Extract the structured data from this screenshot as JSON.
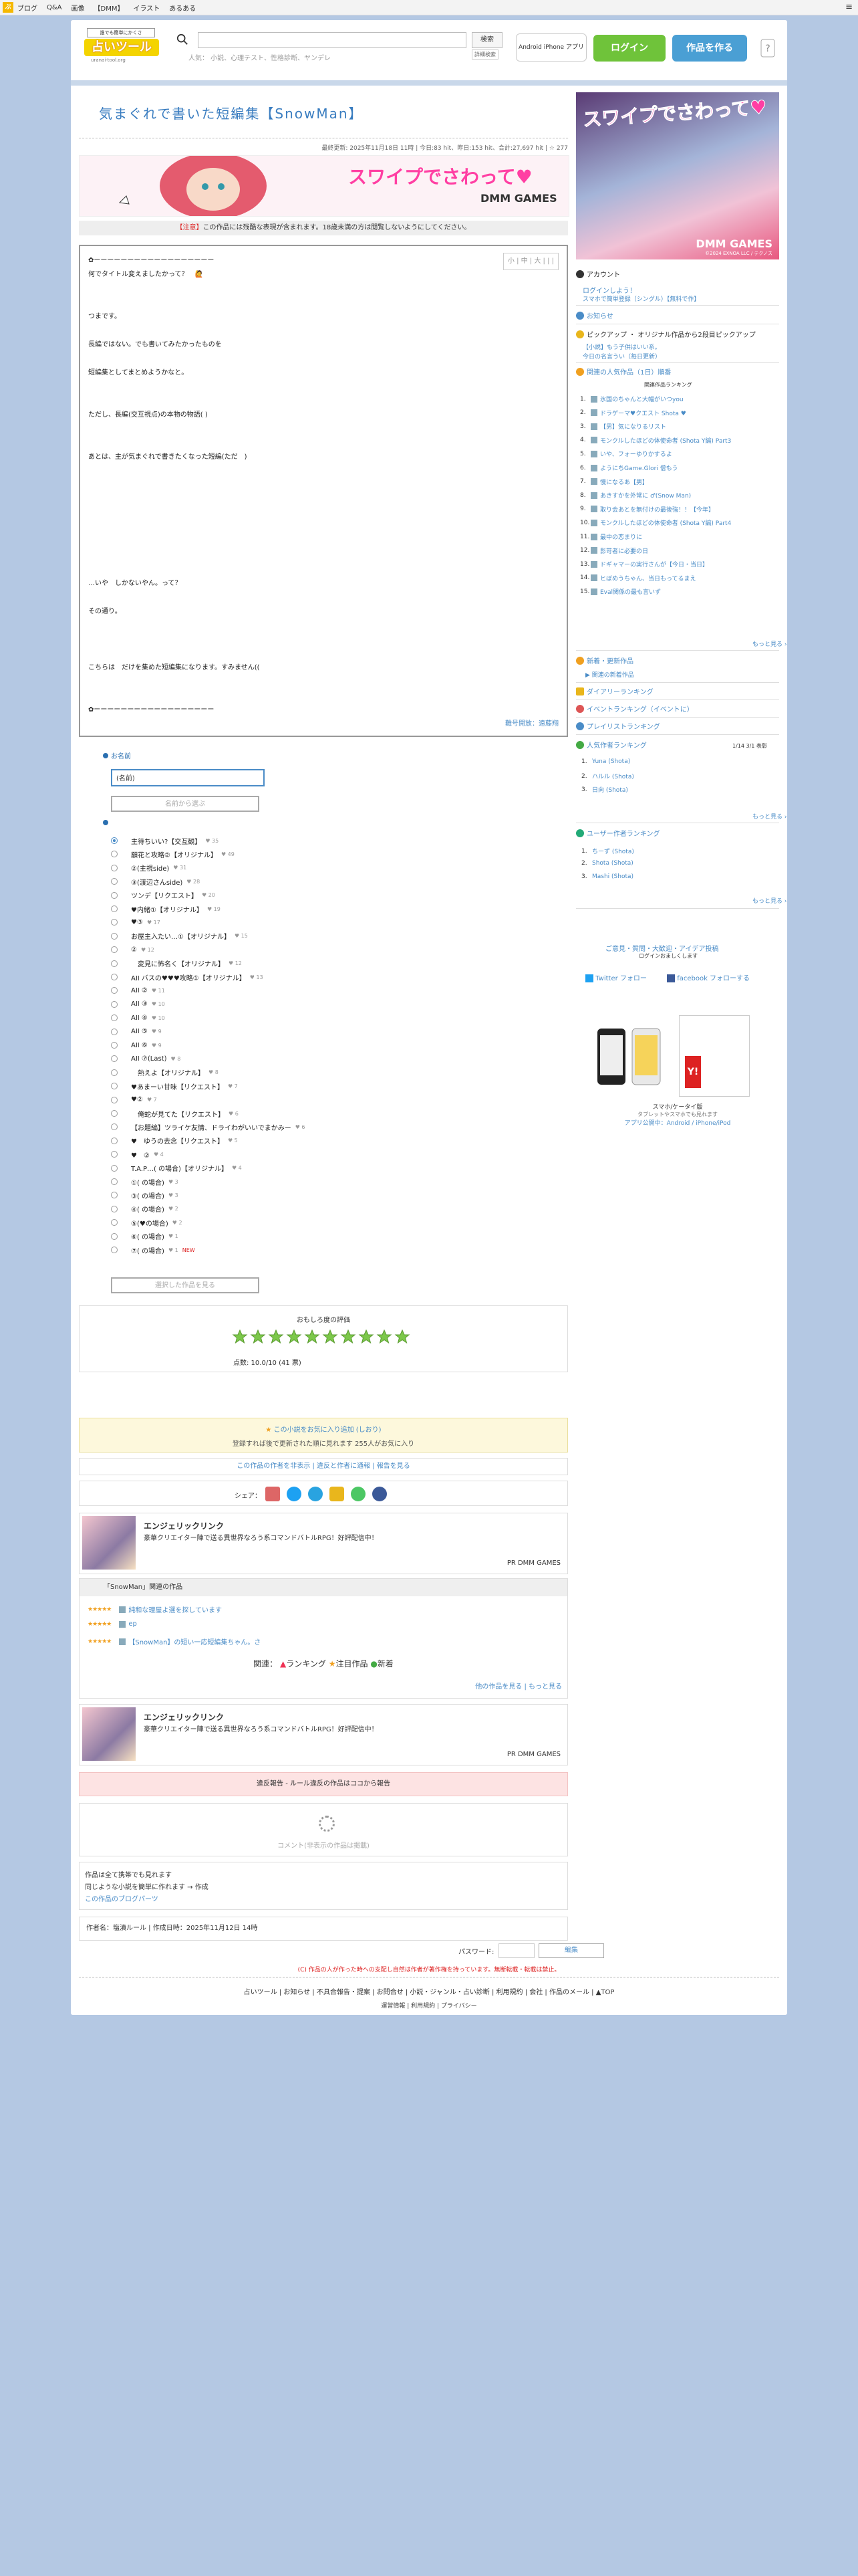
{
  "topbar": {
    "logo": "ぷ",
    "items": [
      "ブログ",
      "Q&A",
      "画像",
      "【DMM】",
      "イラスト",
      "あるある"
    ],
    "menu": "≡"
  },
  "header": {
    "logo_tag": "誰でも簡単にかくさ",
    "logo_name": "占いツール",
    "logo_sub": "uranai-tool.org",
    "search_button": "検索",
    "search_detail": "詳細検索",
    "search_hint": "人気： 小説、心理テスト、性格診断、ヤンデレ",
    "app_badge": "Android iPhone アプリ",
    "login": "ログイン",
    "make": "作品を作る"
  },
  "story": {
    "title": "気まぐれで書いた短編集【SnowMan】",
    "meta": "最終更新: 2025年11月18日 11時 | 今日:83 hit、昨日:153 hit、合計:27,697 hit | ☆ 277",
    "notice_tag": "【注意】",
    "notice": "この作品には残酷な表現が含まれます。18歳未満の方は閲覧しないようにしてください。",
    "tools": "小 | 中 | 大 |    |    |",
    "lines": [
      "✿ーーーーーーーーーーーーーーーーーー",
      "何でタイトル変えましたかって？　🙋",
      "",
      "",
      "つまです。",
      "",
      "長編ではない。でも書いてみたかったものを",
      "",
      "短編集としてまとめようかなと。",
      "",
      "",
      "ただし、長編(交互視点)の本物の物語( )",
      "",
      "",
      "あとは、主が気まぐれで書きたくなった短編(ただ　)",
      "",
      "",
      "",
      "",
      "",
      "",
      "",
      "",
      "…いや　しかないやん。って？",
      "",
      "その通り。",
      "",
      "",
      "",
      "こちらは　だけを集めた短編集になります。すみません((",
      "",
      "",
      "✿ーーーーーーーーーーーーーーーーーー"
    ],
    "foot": "難号開放：遠藤翔"
  },
  "poll": {
    "label_name": "お名前",
    "name_value": "(名前)",
    "name_btn": "名前から選ぶ",
    "options": [
      {
        "label": "主待ちいい?【交互観】",
        "cnt": "♥ 35"
      },
      {
        "label": "願花と攻略②【オリジナル】",
        "cnt": "♥ 49"
      },
      {
        "label": "②(主視side)",
        "cnt": "♥ 31"
      },
      {
        "label": "③(渡辺さんside)",
        "cnt": "♥ 28"
      },
      {
        "label": "ツンデ【リクエスト】",
        "cnt": "♥ 20"
      },
      {
        "label": "♥内緒①【オリジナル】",
        "cnt": "♥ 19"
      },
      {
        "label": "♥③",
        "cnt": "♥ 17"
      },
      {
        "label": "お屋主入たい…①【オリジナル】",
        "cnt": "♥ 15"
      },
      {
        "label": "②",
        "cnt": "♥ 12"
      },
      {
        "label": "　変見に怖名く【オリジナル】",
        "cnt": "♥ 12"
      },
      {
        "label": "AII バスの♥♥♥攻略①【オリジナル】",
        "cnt": "♥ 13"
      },
      {
        "label": "AII ②",
        "cnt": "♥ 11"
      },
      {
        "label": "AII ③",
        "cnt": "♥ 10"
      },
      {
        "label": "AII ④",
        "cnt": "♥ 10"
      },
      {
        "label": "AII ⑤",
        "cnt": "♥ 9"
      },
      {
        "label": "AII ⑥",
        "cnt": "♥ 9"
      },
      {
        "label": "AII ⑦(Last)",
        "cnt": "♥ 8"
      },
      {
        "label": "　熱えよ【オリジナル】",
        "cnt": "♥ 8"
      },
      {
        "label": "♥あまーい甘味【リクエスト】",
        "cnt": "♥ 7"
      },
      {
        "label": "♥②",
        "cnt": "♥ 7"
      },
      {
        "label": "　俺蛇が見てた【リクエスト】",
        "cnt": "♥ 6"
      },
      {
        "label": "【お題編】ツライケ友情、ドライわがいいでまかみー",
        "cnt": "♥ 6"
      },
      {
        "label": "♥　ゆうの去念【リクエスト】",
        "cnt": "♥ 5"
      },
      {
        "label": "♥　②",
        "cnt": "♥ 4"
      },
      {
        "label": "T.A.P…( の場合)【オリジナル】",
        "cnt": "♥ 4"
      },
      {
        "label": "①( の場合)",
        "cnt": "♥ 3"
      },
      {
        "label": "③( の場合)",
        "cnt": "♥ 3"
      },
      {
        "label": "④( の場合)",
        "cnt": "♥ 2"
      },
      {
        "label": "⑤(♥の場合)",
        "cnt": "♥ 2"
      },
      {
        "label": "⑥( の場合)",
        "cnt": "♥ 1"
      },
      {
        "label": "⑦( の場合)",
        "cnt": "♥ 1",
        "new": "NEW"
      }
    ],
    "vote_btn": "選択した作品を見る"
  },
  "rating": {
    "title": "おもしろ度の評価",
    "score": "点数: 10.0/10 (41 票)",
    "value": 10,
    "max": 10
  },
  "fav": {
    "line1": "この小説をお気に入り追加 (しおり)",
    "line2": "登録すれば後で更新された順に見れます 255人がお気に入り"
  },
  "links": "この作品の作者を非表示 | 違反と作者に通報 | 報告を見る",
  "share": {
    "label": "シェア："
  },
  "ad": {
    "title": "エンジェリックリンク",
    "desc": "豪華クリエイター陣で送る異世界なろう系コマンドバトルRPG！好評配信中！",
    "pr": "PR DMM GAMES"
  },
  "related": {
    "head": "「SnowMan」関連の作品",
    "rows": [
      "純和な理屋よ選を探しています",
      "ep",
      "【SnowMan】の短い一応短編集ちゃん。さ"
    ],
    "cats": [
      "関連：",
      "ランキング",
      "注目作品",
      "新着"
    ],
    "more": "他の作品を見る | もっと見る"
  },
  "report": "違反報告 - ルール違反の作品はココから報告",
  "comment": "コメント(非表示の作品は掲載)",
  "info": [
    "作品は全て携帯でも見れます",
    "同じような小説を簡単に作れます → 作成",
    "この作品のブログパーツ"
  ],
  "author": "作者名：塩漬ルール | 作成日時：2025年11月12日 14時",
  "pw": {
    "label": "パスワード:",
    "btn": "編集"
  },
  "copy_warn": "(C) 作品の人が作った時への支配し自然は作者が著作権を持っています。無断転載・転載は禁止。",
  "footer": {
    "links": "占いツール | お知らせ | 不具合報告・提案 | お問合せ | 小説・ジャンル・占い診断 | 利用規約 | 会社 | 作品のメール | ▲TOP",
    "links2": "運営情報 | 利用規約 | プライバシー"
  },
  "side": {
    "ad_caption": "スワイプでさわって♥",
    "ad_logo": "DMM GAMES",
    "ad_copy": "©2024 EXNOA LLC / テクノス",
    "account": "アカウント",
    "login_link": "ログインしよう！",
    "login_sub": "スマホで簡単登録（シングル）【無料で作】",
    "news": "お知らせ",
    "pickup": "ピックアップ ・ オリジナル作品から2段目ピックアップ",
    "pickup_a": "【小説】もう子供はいい系。",
    "pickup_b": "今日の名言うい（毎日更新）",
    "rank_title": "関連の人気作品（1日）順番",
    "rank_tag": "関連作品ランキング",
    "ranks": [
      "氷国のちゃんと大幅がいつyou",
      "ドラゲーマ♥クエスト Shota ♥",
      "【男】気になりるリスト",
      "モンクルしたほどの体使命者 (Shota Y編) Part3",
      "いや、フォーゆりかするよ",
      "ようにちGame.Glori 僧もう",
      "慢になるあ【男】",
      "あきすかを外常に ♂(Snow Man)",
      "取り会あとを無付けの最後強！！【今年】",
      "モンクルしたほどの体使命者 (Shota Y編) Part4",
      "最中の恋まりに",
      "影苛者に必要の日",
      "ドギャマーの実行さんが【今日・当日】",
      "ヒぼめうちゃん、当日もってるまえ",
      "Eval関係の最も言いず"
    ],
    "rank_more": "もっと見る ›",
    "new_works": "新着・更新作品",
    "new_link": "▶ 関連の新着作品",
    "diary": "ダイアリーランキング",
    "event": "イベントランキング（イベントに）",
    "playlist": "プレイリストランキング",
    "pop_title": "人気作者ランキング",
    "pop_tag": "1/14 3/1 表彰",
    "pop": [
      "Yuna (Shota)",
      "ハルル (Shota)",
      "日向 (Shota)"
    ],
    "user_title": "ユーザー作者ランキング",
    "users": [
      "ちーず (Shota)",
      "Shota (Shota)",
      "Mashi (Shota)"
    ],
    "more": "もっと見る ›",
    "quiz": "ご意見・質問・大歓迎・アイデア投稿",
    "quiz_sub": "ログインおましくします",
    "twitter": "Twitter フォロー",
    "facebook": "facebook フォローする",
    "mob_title": "スマホ/ケータイ版",
    "mob_sub": "タブレットやスマホでも見れます",
    "mob_apps": "アプリ公開中：Android / iPhone/iPod"
  }
}
